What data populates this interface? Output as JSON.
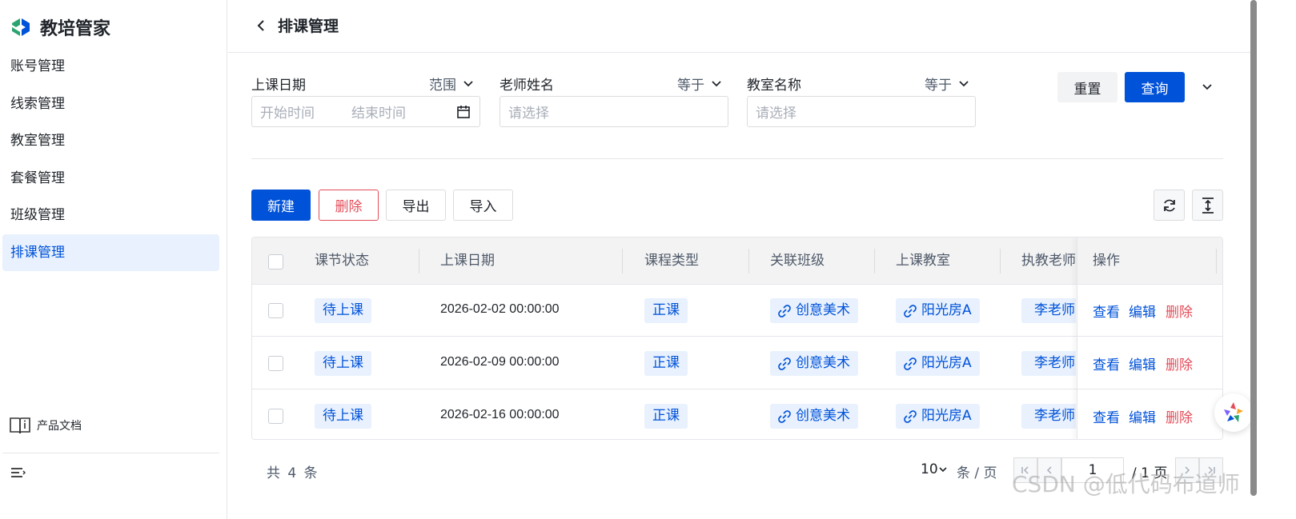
{
  "app": {
    "name": "教培管家"
  },
  "sidebar": {
    "items": [
      {
        "label": "账号管理"
      },
      {
        "label": "线索管理"
      },
      {
        "label": "教室管理"
      },
      {
        "label": "套餐管理"
      },
      {
        "label": "班级管理"
      },
      {
        "label": "排课管理",
        "active": true
      }
    ],
    "doc_label": "产品文档"
  },
  "header": {
    "title": "排课管理"
  },
  "filters": {
    "date": {
      "label": "上课日期",
      "op": "范围",
      "start_placeholder": "开始时间",
      "end_placeholder": "结束时间"
    },
    "teacher": {
      "label": "老师姓名",
      "op": "等于",
      "placeholder": "请选择"
    },
    "room": {
      "label": "教室名称",
      "op": "等于",
      "placeholder": "请选择"
    },
    "reset_label": "重置",
    "query_label": "查询"
  },
  "toolbar": {
    "new": "新建",
    "delete": "删除",
    "export": "导出",
    "import": "导入"
  },
  "table": {
    "columns": [
      "课节状态",
      "上课日期",
      "课程类型",
      "关联班级",
      "上课教室",
      "执教老师",
      "操作"
    ],
    "rows": [
      {
        "status": "待上课",
        "date": "2026-02-02 00:00:00",
        "type": "正课",
        "class": "创意美术",
        "room": "阳光房A",
        "teacher": "李老师"
      },
      {
        "status": "待上课",
        "date": "2026-02-09 00:00:00",
        "type": "正课",
        "class": "创意美术",
        "room": "阳光房A",
        "teacher": "李老师"
      },
      {
        "status": "待上课",
        "date": "2026-02-16 00:00:00",
        "type": "正课",
        "class": "创意美术",
        "room": "阳光房A",
        "teacher": "李老师"
      }
    ],
    "actions": {
      "view": "查看",
      "edit": "编辑",
      "delete": "删除"
    }
  },
  "pagination": {
    "total_text": "共 4 条",
    "page_size": "10",
    "unit": "条 / 页",
    "current": "1",
    "total_pages": "/ 1 页"
  },
  "watermark": "CSDN @低代码布道师",
  "colors": {
    "primary": "#0052d9",
    "danger": "#e34d59",
    "tag_bg": "#e8f1fd"
  }
}
